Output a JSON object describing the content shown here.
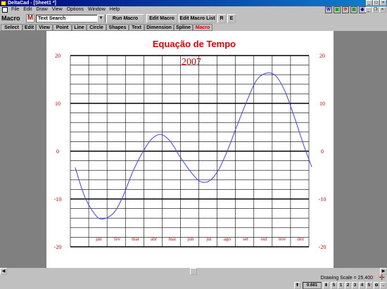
{
  "window": {
    "title": "DeltaCad - [Sheet1 *]"
  },
  "menu": [
    "File",
    "Edit",
    "Draw",
    "View",
    "Options",
    "Window",
    "Help"
  ],
  "toolbar": {
    "label": "Macro",
    "m_icon": "M",
    "selected_macro": "Text Search",
    "run_macro": "Run Macro",
    "edit_macro": "Edit Macro",
    "edit_macro_list": "Edit Macro List",
    "r_button": "R",
    "e_button": "E"
  },
  "tabs": [
    "Select",
    "Edit",
    "View",
    "Point",
    "Line",
    "Circle",
    "Shapes",
    "Text",
    "Dimension",
    "Spline",
    "Macro"
  ],
  "active_tab": "Macro",
  "chart_data": {
    "type": "line",
    "title": "Equação de Tempo",
    "subtitle": "2007",
    "categories": [
      "jan",
      "fev",
      "mar",
      "abr",
      "mai",
      "jun",
      "jul",
      "ago",
      "set",
      "out",
      "nov",
      "dez"
    ],
    "y_ticks": [
      "20",
      "10",
      "0",
      "-10",
      "-20"
    ],
    "ylim": [
      -20,
      20
    ],
    "xlim": [
      0,
      12.5
    ],
    "series": [
      {
        "color": "#4040ff",
        "x": [
          0.0,
          0.5,
          1.0,
          1.4,
          2.0,
          2.5,
          3.0,
          3.5,
          4.0,
          4.5,
          5.0,
          5.5,
          6.0,
          6.5,
          7.0,
          7.5,
          8.0,
          8.5,
          9.0,
          9.5,
          10.0,
          10.5,
          11.0,
          11.5,
          12.0,
          12.4
        ],
        "y": [
          -3.4,
          -9.5,
          -13.0,
          -14.2,
          -13.0,
          -9.5,
          -4.5,
          -0.5,
          2.5,
          3.5,
          2.0,
          -1.2,
          -4.0,
          -6.2,
          -6.3,
          -4.0,
          0.3,
          5.5,
          10.5,
          14.8,
          16.3,
          15.8,
          12.5,
          7.0,
          1.0,
          -3.3
        ]
      }
    ]
  },
  "status": {
    "drawing_scale": "Drawing Scale = 25.400",
    "coord_value": "0.681",
    "status_buttons": [
      "5",
      "1",
      "2",
      "3",
      "4",
      "5"
    ]
  },
  "colors": {
    "title": "#e00000",
    "axis_labels": "#e00000",
    "curve": "#4040ff",
    "grid": "#000000",
    "titlebar": "#000080"
  }
}
